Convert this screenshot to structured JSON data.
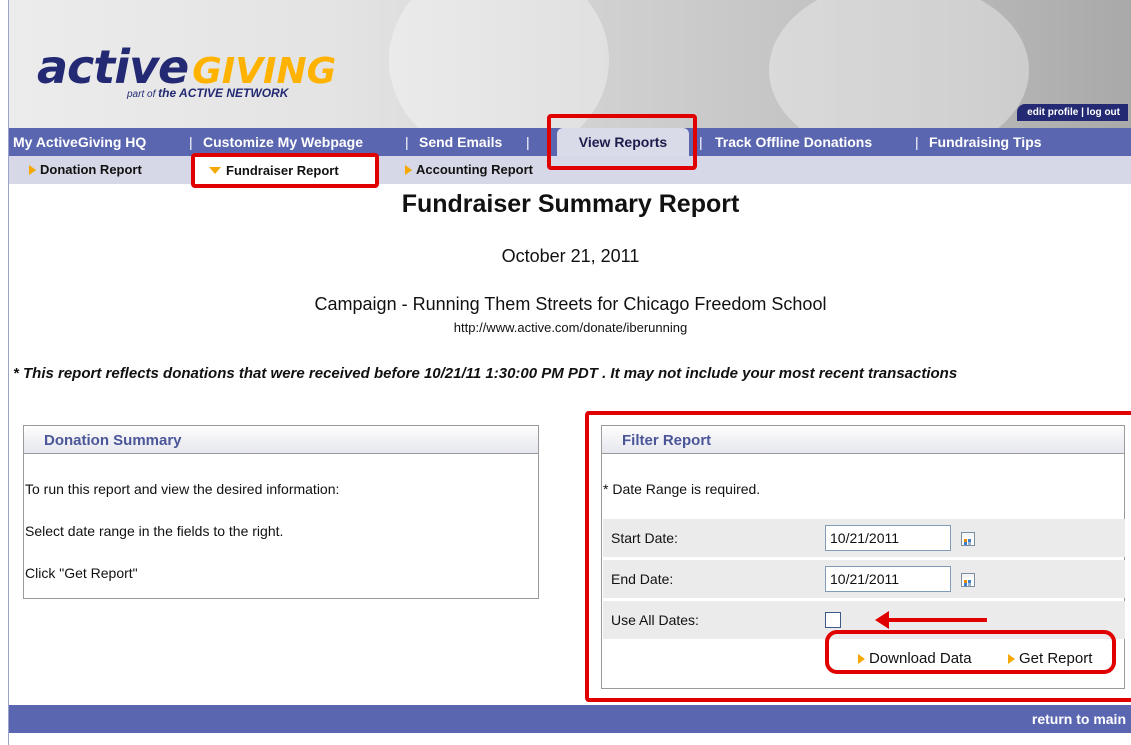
{
  "header": {
    "logo_active": "active",
    "logo_giving": "GIVING",
    "logo_sub_prefix": "part of",
    "logo_sub_brand": "the ACTIVE NETWORK",
    "account_links": {
      "edit_profile": "edit profile",
      "separator": "|",
      "log_out": "log out"
    }
  },
  "nav": {
    "items": [
      "My ActiveGiving HQ",
      "Customize My Webpage",
      "Send Emails",
      "View Reports",
      "Track Offline Donations",
      "Fundraising Tips"
    ],
    "separator": "|",
    "active": "View Reports"
  },
  "subnav": {
    "items": [
      "Donation Report",
      "Fundraiser Report",
      "Accounting Report"
    ],
    "active": "Fundraiser Report"
  },
  "report": {
    "title": "Fundraiser Summary Report",
    "date": "October 21, 2011",
    "campaign": "Campaign - Running Them Streets for Chicago Freedom School",
    "url": "http://www.active.com/donate/iberunning",
    "note": "* This report reflects donations that were received before 10/21/11 1:30:00 PM PDT . It may not include your most recent transactions"
  },
  "donation_summary": {
    "heading": "Donation Summary",
    "lines": [
      "To run this report and view the desired information:",
      "Select date range in the fields to the right.",
      "Click \"Get Report\""
    ]
  },
  "filter": {
    "heading": "Filter Report",
    "required_note": "* Date Range is required.",
    "start_label": "Start Date:",
    "start_value": "10/21/2011",
    "end_label": "End Date:",
    "end_value": "10/21/2011",
    "all_dates_label": "Use All Dates:",
    "all_dates_checked": false,
    "download_label": "Download Data",
    "get_report_label": "Get Report"
  },
  "footer": {
    "return_label": "return to main"
  },
  "colors": {
    "nav_bar": "#5b66b0",
    "brand_navy": "#232a73",
    "brand_orange": "#f5a800",
    "annotation_red": "#e00000"
  }
}
